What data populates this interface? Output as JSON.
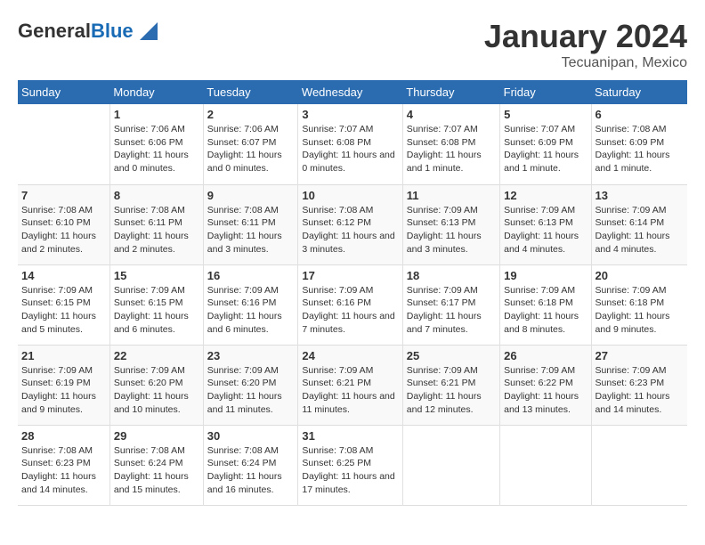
{
  "logo": {
    "general": "General",
    "blue": "Blue"
  },
  "title": "January 2024",
  "location": "Tecuanipan, Mexico",
  "days_header": [
    "Sunday",
    "Monday",
    "Tuesday",
    "Wednesday",
    "Thursday",
    "Friday",
    "Saturday"
  ],
  "weeks": [
    [
      {
        "day": "",
        "sunrise": "",
        "sunset": "",
        "daylight": ""
      },
      {
        "day": "1",
        "sunrise": "Sunrise: 7:06 AM",
        "sunset": "Sunset: 6:06 PM",
        "daylight": "Daylight: 11 hours and 0 minutes."
      },
      {
        "day": "2",
        "sunrise": "Sunrise: 7:06 AM",
        "sunset": "Sunset: 6:07 PM",
        "daylight": "Daylight: 11 hours and 0 minutes."
      },
      {
        "day": "3",
        "sunrise": "Sunrise: 7:07 AM",
        "sunset": "Sunset: 6:08 PM",
        "daylight": "Daylight: 11 hours and 0 minutes."
      },
      {
        "day": "4",
        "sunrise": "Sunrise: 7:07 AM",
        "sunset": "Sunset: 6:08 PM",
        "daylight": "Daylight: 11 hours and 1 minute."
      },
      {
        "day": "5",
        "sunrise": "Sunrise: 7:07 AM",
        "sunset": "Sunset: 6:09 PM",
        "daylight": "Daylight: 11 hours and 1 minute."
      },
      {
        "day": "6",
        "sunrise": "Sunrise: 7:08 AM",
        "sunset": "Sunset: 6:09 PM",
        "daylight": "Daylight: 11 hours and 1 minute."
      }
    ],
    [
      {
        "day": "7",
        "sunrise": "Sunrise: 7:08 AM",
        "sunset": "Sunset: 6:10 PM",
        "daylight": "Daylight: 11 hours and 2 minutes."
      },
      {
        "day": "8",
        "sunrise": "Sunrise: 7:08 AM",
        "sunset": "Sunset: 6:11 PM",
        "daylight": "Daylight: 11 hours and 2 minutes."
      },
      {
        "day": "9",
        "sunrise": "Sunrise: 7:08 AM",
        "sunset": "Sunset: 6:11 PM",
        "daylight": "Daylight: 11 hours and 3 minutes."
      },
      {
        "day": "10",
        "sunrise": "Sunrise: 7:08 AM",
        "sunset": "Sunset: 6:12 PM",
        "daylight": "Daylight: 11 hours and 3 minutes."
      },
      {
        "day": "11",
        "sunrise": "Sunrise: 7:09 AM",
        "sunset": "Sunset: 6:13 PM",
        "daylight": "Daylight: 11 hours and 3 minutes."
      },
      {
        "day": "12",
        "sunrise": "Sunrise: 7:09 AM",
        "sunset": "Sunset: 6:13 PM",
        "daylight": "Daylight: 11 hours and 4 minutes."
      },
      {
        "day": "13",
        "sunrise": "Sunrise: 7:09 AM",
        "sunset": "Sunset: 6:14 PM",
        "daylight": "Daylight: 11 hours and 4 minutes."
      }
    ],
    [
      {
        "day": "14",
        "sunrise": "Sunrise: 7:09 AM",
        "sunset": "Sunset: 6:15 PM",
        "daylight": "Daylight: 11 hours and 5 minutes."
      },
      {
        "day": "15",
        "sunrise": "Sunrise: 7:09 AM",
        "sunset": "Sunset: 6:15 PM",
        "daylight": "Daylight: 11 hours and 6 minutes."
      },
      {
        "day": "16",
        "sunrise": "Sunrise: 7:09 AM",
        "sunset": "Sunset: 6:16 PM",
        "daylight": "Daylight: 11 hours and 6 minutes."
      },
      {
        "day": "17",
        "sunrise": "Sunrise: 7:09 AM",
        "sunset": "Sunset: 6:16 PM",
        "daylight": "Daylight: 11 hours and 7 minutes."
      },
      {
        "day": "18",
        "sunrise": "Sunrise: 7:09 AM",
        "sunset": "Sunset: 6:17 PM",
        "daylight": "Daylight: 11 hours and 7 minutes."
      },
      {
        "day": "19",
        "sunrise": "Sunrise: 7:09 AM",
        "sunset": "Sunset: 6:18 PM",
        "daylight": "Daylight: 11 hours and 8 minutes."
      },
      {
        "day": "20",
        "sunrise": "Sunrise: 7:09 AM",
        "sunset": "Sunset: 6:18 PM",
        "daylight": "Daylight: 11 hours and 9 minutes."
      }
    ],
    [
      {
        "day": "21",
        "sunrise": "Sunrise: 7:09 AM",
        "sunset": "Sunset: 6:19 PM",
        "daylight": "Daylight: 11 hours and 9 minutes."
      },
      {
        "day": "22",
        "sunrise": "Sunrise: 7:09 AM",
        "sunset": "Sunset: 6:20 PM",
        "daylight": "Daylight: 11 hours and 10 minutes."
      },
      {
        "day": "23",
        "sunrise": "Sunrise: 7:09 AM",
        "sunset": "Sunset: 6:20 PM",
        "daylight": "Daylight: 11 hours and 11 minutes."
      },
      {
        "day": "24",
        "sunrise": "Sunrise: 7:09 AM",
        "sunset": "Sunset: 6:21 PM",
        "daylight": "Daylight: 11 hours and 11 minutes."
      },
      {
        "day": "25",
        "sunrise": "Sunrise: 7:09 AM",
        "sunset": "Sunset: 6:21 PM",
        "daylight": "Daylight: 11 hours and 12 minutes."
      },
      {
        "day": "26",
        "sunrise": "Sunrise: 7:09 AM",
        "sunset": "Sunset: 6:22 PM",
        "daylight": "Daylight: 11 hours and 13 minutes."
      },
      {
        "day": "27",
        "sunrise": "Sunrise: 7:09 AM",
        "sunset": "Sunset: 6:23 PM",
        "daylight": "Daylight: 11 hours and 14 minutes."
      }
    ],
    [
      {
        "day": "28",
        "sunrise": "Sunrise: 7:08 AM",
        "sunset": "Sunset: 6:23 PM",
        "daylight": "Daylight: 11 hours and 14 minutes."
      },
      {
        "day": "29",
        "sunrise": "Sunrise: 7:08 AM",
        "sunset": "Sunset: 6:24 PM",
        "daylight": "Daylight: 11 hours and 15 minutes."
      },
      {
        "day": "30",
        "sunrise": "Sunrise: 7:08 AM",
        "sunset": "Sunset: 6:24 PM",
        "daylight": "Daylight: 11 hours and 16 minutes."
      },
      {
        "day": "31",
        "sunrise": "Sunrise: 7:08 AM",
        "sunset": "Sunset: 6:25 PM",
        "daylight": "Daylight: 11 hours and 17 minutes."
      },
      {
        "day": "",
        "sunrise": "",
        "sunset": "",
        "daylight": ""
      },
      {
        "day": "",
        "sunrise": "",
        "sunset": "",
        "daylight": ""
      },
      {
        "day": "",
        "sunrise": "",
        "sunset": "",
        "daylight": ""
      }
    ]
  ]
}
